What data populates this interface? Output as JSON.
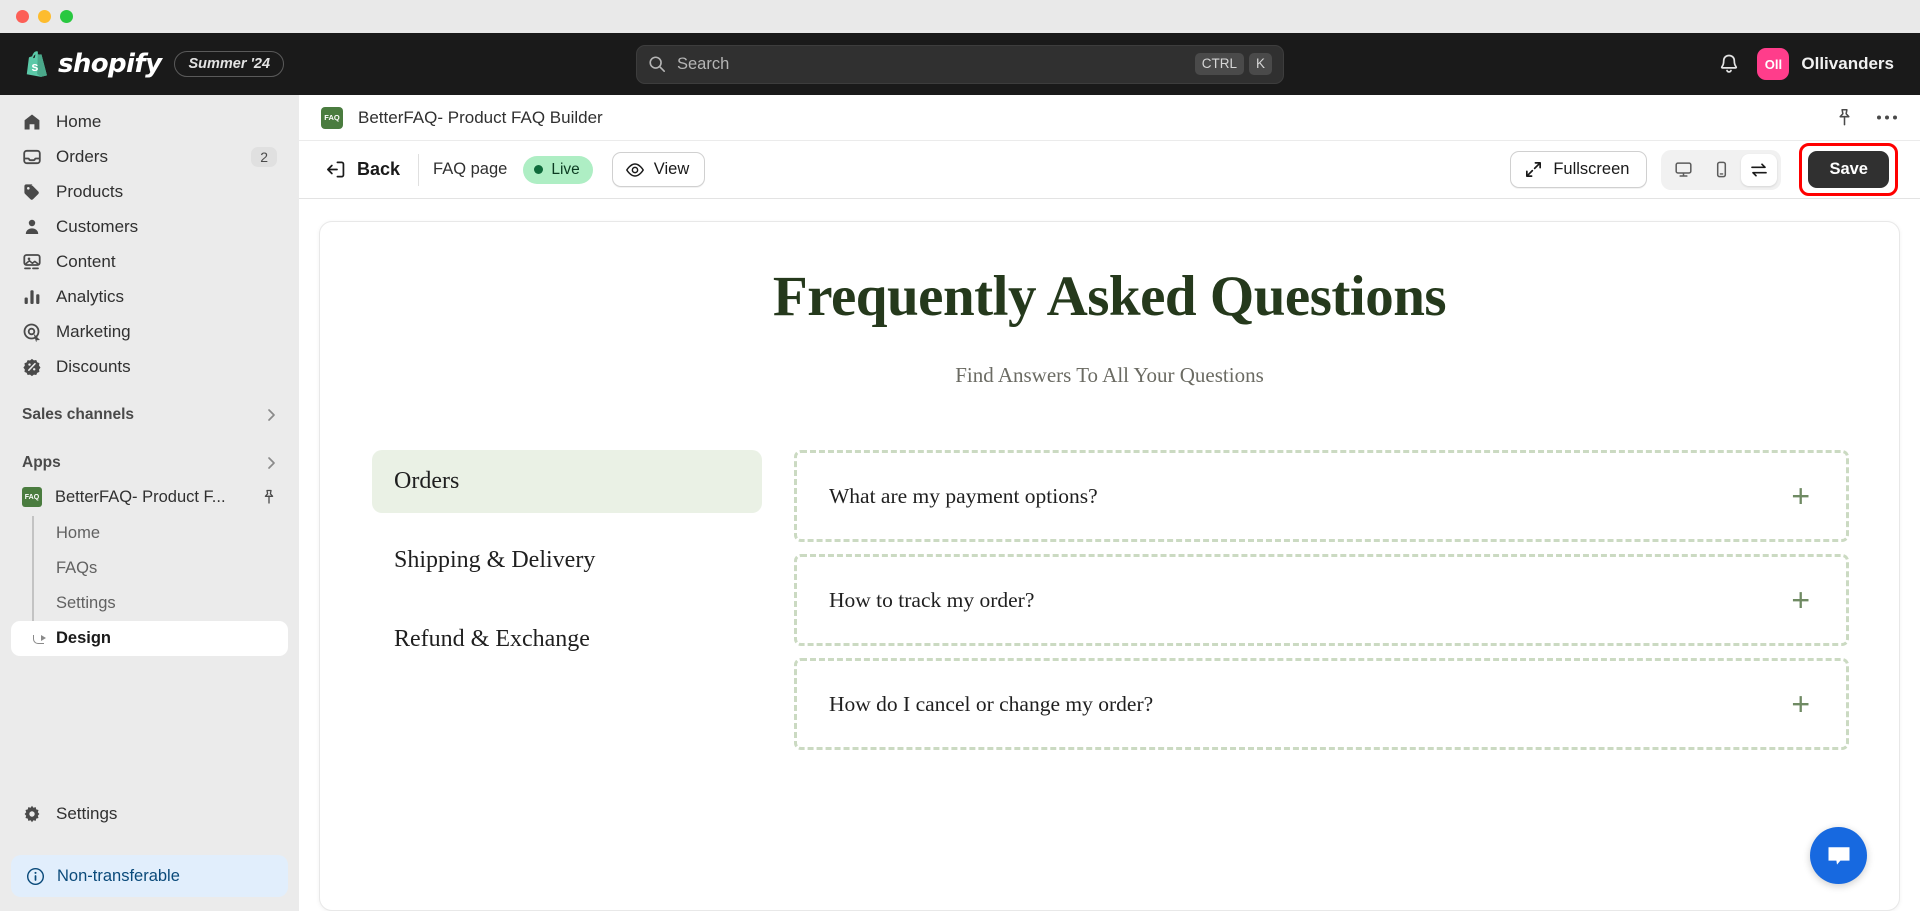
{
  "window": {
    "controls": [
      "close",
      "minimize",
      "maximize"
    ]
  },
  "topbar": {
    "brand": "shopify",
    "season_badge": "Summer '24",
    "search": {
      "placeholder": "Search",
      "value": "",
      "shortcut_mod": "CTRL",
      "shortcut_key": "K"
    },
    "notifications_icon": "bell-icon",
    "user": {
      "initials": "Oll",
      "name": "Ollivanders",
      "avatar_color": "#ff3d8b"
    }
  },
  "sidebar": {
    "nav": [
      {
        "label": "Home",
        "icon": "home-icon",
        "badge": ""
      },
      {
        "label": "Orders",
        "icon": "orders-icon",
        "badge": "2"
      },
      {
        "label": "Products",
        "icon": "products-icon",
        "badge": ""
      },
      {
        "label": "Customers",
        "icon": "customers-icon",
        "badge": ""
      },
      {
        "label": "Content",
        "icon": "content-icon",
        "badge": ""
      },
      {
        "label": "Analytics",
        "icon": "analytics-icon",
        "badge": ""
      },
      {
        "label": "Marketing",
        "icon": "marketing-icon",
        "badge": ""
      },
      {
        "label": "Discounts",
        "icon": "discounts-icon",
        "badge": ""
      }
    ],
    "sales_channels": {
      "label": "Sales channels",
      "chevron": "chevron-right-icon"
    },
    "apps": {
      "label": "Apps",
      "chevron": "chevron-right-icon"
    },
    "app": {
      "favicon_text": "FAQ",
      "name": "BetterFAQ- Product F...",
      "pin_icon": "pin-icon",
      "subitems": [
        {
          "label": "Home",
          "active": false
        },
        {
          "label": "FAQs",
          "active": false
        },
        {
          "label": "Settings",
          "active": false
        },
        {
          "label": "Design",
          "active": true
        }
      ]
    },
    "settings": {
      "label": "Settings",
      "icon": "gear-icon"
    },
    "non_transferable": {
      "label": "Non-transferable",
      "icon": "info-icon",
      "bg": "#e1eefc"
    }
  },
  "app_header": {
    "favicon_text": "FAQ",
    "title": "BetterFAQ- Product FAQ Builder",
    "pin_icon": "pin-icon",
    "more_icon": "more-horizontal-icon"
  },
  "toolbar": {
    "back_label": "Back",
    "page_label": "FAQ page",
    "status_badge": "Live",
    "status_color": "#aeeec4",
    "view_label": "View",
    "fullscreen_label": "Fullscreen",
    "devices": [
      {
        "icon": "desktop-icon",
        "active": false
      },
      {
        "icon": "mobile-icon",
        "active": false
      },
      {
        "icon": "swap-icon",
        "active": true
      }
    ],
    "save_label": "Save",
    "save_highlight_color": "#ff0000"
  },
  "preview": {
    "title": "Frequently Asked Questions",
    "subtitle": "Find Answers To All Your Questions",
    "title_color": "#25391c",
    "categories": [
      {
        "label": "Orders",
        "active": true
      },
      {
        "label": "Shipping & Delivery",
        "active": false
      },
      {
        "label": "Refund & Exchange",
        "active": false
      }
    ],
    "questions": [
      {
        "text": "What are my payment options?",
        "expand_icon": "plus-icon"
      },
      {
        "text": "How to track my order?",
        "expand_icon": "plus-icon"
      },
      {
        "text": "How do I cancel or change my order?",
        "expand_icon": "plus-icon"
      }
    ],
    "chat_widget_icon": "chat-bubble-icon",
    "chat_widget_color": "#1769e0"
  }
}
